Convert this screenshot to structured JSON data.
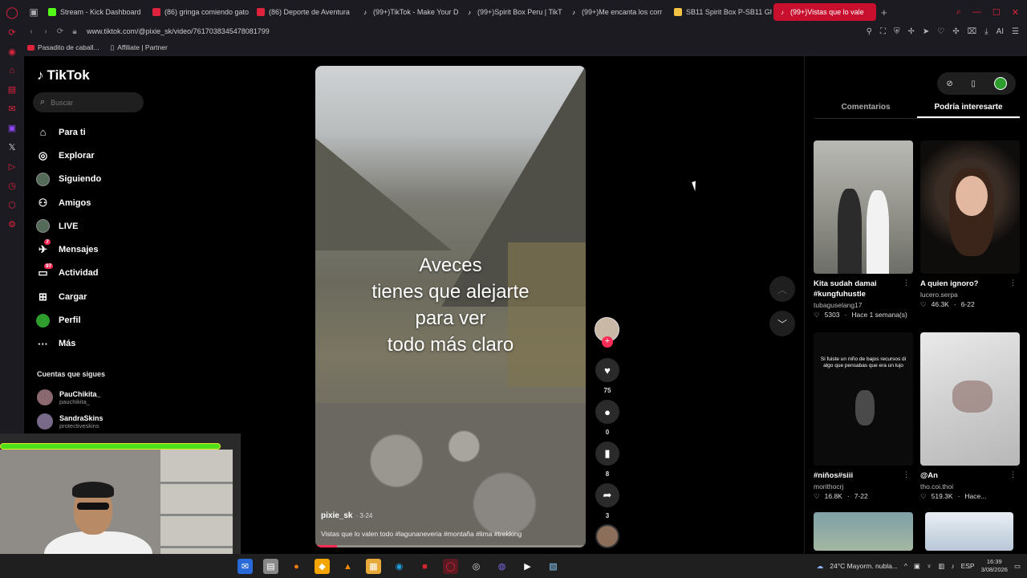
{
  "browser": {
    "tabs": [
      {
        "label": "Stream - Kick Dashboard",
        "icon": "kick-icon",
        "color": "#53fc18"
      },
      {
        "label": "(86) gringa comiendo gato",
        "icon": "youtube-icon",
        "color": "#e0233d"
      },
      {
        "label": "(86) Deporte de Aventura",
        "icon": "youtube-icon",
        "color": "#e0233d"
      },
      {
        "label": "(99+)TikTok - Make Your D",
        "icon": "tiktok-icon",
        "color": "#ffffff"
      },
      {
        "label": "(99+)Spirit Box Peru | TikT",
        "icon": "tiktok-icon",
        "color": "#ffffff"
      },
      {
        "label": "(99+)Me encanta los corr",
        "icon": "tiktok-icon",
        "color": "#ffffff"
      },
      {
        "label": "SB11 Spirit Box P-SB11 Gho",
        "icon": "shop-icon",
        "color": "#f5c242"
      },
      {
        "label": "(99+)Vistas que lo vale",
        "icon": "tiktok-icon",
        "color": "#ffffff"
      }
    ],
    "url": "www.tiktok.com/@pixie_sk/video/7617038345478081799",
    "bookmarks": [
      {
        "label": "Pasadito de caball..."
      },
      {
        "label": "Affiliate | Partner"
      }
    ],
    "ai_label": "AI"
  },
  "sidebar": {
    "logo": "TikTok",
    "search_placeholder": "Buscar",
    "items": [
      {
        "label": "Para ti",
        "icon": "home-icon",
        "glyph": "⌂"
      },
      {
        "label": "Explorar",
        "icon": "compass-icon",
        "glyph": "◎"
      },
      {
        "label": "Siguiendo",
        "icon": "following-avatar-icon",
        "glyph": ""
      },
      {
        "label": "Amigos",
        "icon": "friends-icon",
        "glyph": "⚇"
      },
      {
        "label": "LIVE",
        "icon": "live-avatar-icon",
        "glyph": ""
      },
      {
        "label": "Mensajes",
        "icon": "messages-icon",
        "glyph": "✈",
        "badge": "7"
      },
      {
        "label": "Actividad",
        "icon": "activity-icon",
        "glyph": "▭",
        "badge": "97"
      },
      {
        "label": "Cargar",
        "icon": "upload-icon",
        "glyph": "⊞"
      },
      {
        "label": "Perfil",
        "icon": "profile-avatar-icon",
        "glyph": ""
      },
      {
        "label": "Más",
        "icon": "more-icon",
        "glyph": "···"
      }
    ],
    "following_title": "Cuentas que sigues",
    "following": [
      {
        "name": "PauChikita_",
        "handle": "pauchikita_"
      },
      {
        "name": "SandraSkins",
        "handle": "protectiveskins"
      }
    ]
  },
  "video": {
    "caption_lines": [
      "Aveces",
      "tienes que alejarte",
      "para ver",
      "todo más claro"
    ],
    "author": "pixie_sk",
    "time": "· 3-24",
    "description": "Vistas que lo valen todo #lagunaneveria #montaña #lima #trekking",
    "progress": 0.08
  },
  "actions": {
    "likes": "75",
    "comments": "0",
    "saves": "8",
    "shares": "3"
  },
  "right_panel": {
    "tabs": [
      "Comentarios",
      "Podría interesarte"
    ],
    "active_tab": 1,
    "cards": [
      {
        "title": "Kita sudah damai #kungfuhustle",
        "user": "tubaguselang17",
        "likes": "5303",
        "date": "Hace 1 semana(s)",
        "thumb": "t1"
      },
      {
        "title": "A quien ignoro?",
        "user": "lucero.serpa",
        "likes": "46.3K",
        "date": "6-22",
        "thumb": "t2"
      },
      {
        "title": "#niños#siii",
        "user": "morithocrj",
        "likes": "16.8K",
        "date": "7-22",
        "thumb": "t3",
        "overlay": "Si fuiste un niño de bajos recursos di algo que pensabas que era un lujo"
      },
      {
        "title": "@An",
        "user": "tho.coi.thoi",
        "likes": "519.3K",
        "date": "Hace...",
        "thumb": "t4"
      }
    ]
  },
  "taskbar": {
    "weather": "24°C  Mayorm. nubla...",
    "lang": "ESP",
    "time": "16:39",
    "date": "3/08/2026"
  }
}
